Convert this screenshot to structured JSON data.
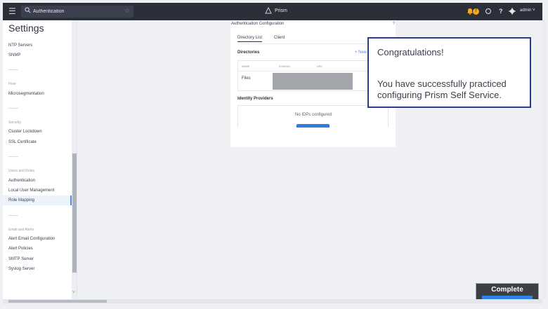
{
  "topbar": {
    "search_value": "Authentication",
    "brand": "Prism",
    "alert_count": "!",
    "help": "?",
    "user": "admin ˅"
  },
  "sidebar": {
    "title": "Settings",
    "items": {
      "ntp_servers": "NTP Servers",
      "snmp": "SNMP",
      "flow_heading": "Flow",
      "microsegmentation": "Microsegmentation",
      "security_heading": "Security",
      "cluster_lockdown": "Cluster Lockdown",
      "ssl_certificate": "SSL Certificate",
      "users_heading": "Users and Roles",
      "authentication": "Authentication",
      "local_user_management": "Local User Management",
      "role_mapping": "Role Mapping",
      "alerts_heading": "Email and Alerts",
      "alert_email_configuration": "Alert Email Configuration",
      "alert_policies": "Alert Policies",
      "smtp_server": "SMTP Server",
      "syslog_server": "Syslog Server"
    },
    "active_item": "Authentication"
  },
  "main": {
    "header": "Authentication Configuration",
    "help": "?",
    "tabs": [
      "Directory List",
      "Client"
    ],
    "directories_title": "Directories",
    "new_directory": "+ New",
    "columns": [
      "NAME",
      "DOMAIN",
      "URL"
    ],
    "rows": [
      {
        "name": "Files"
      }
    ],
    "idp_title": "Identity Providers",
    "idp_empty": "No IDPs configured"
  },
  "toast": {
    "title": "Congratulations!",
    "body": "You have successfully practiced configuring Prism Self Service."
  },
  "complete_button": {
    "label": "Complete"
  },
  "colors": {
    "topbar": "#2b2f3a",
    "accent": "#4a8fe7",
    "toast_border": "#213f8a",
    "complete_bar": "#2e84e6"
  }
}
